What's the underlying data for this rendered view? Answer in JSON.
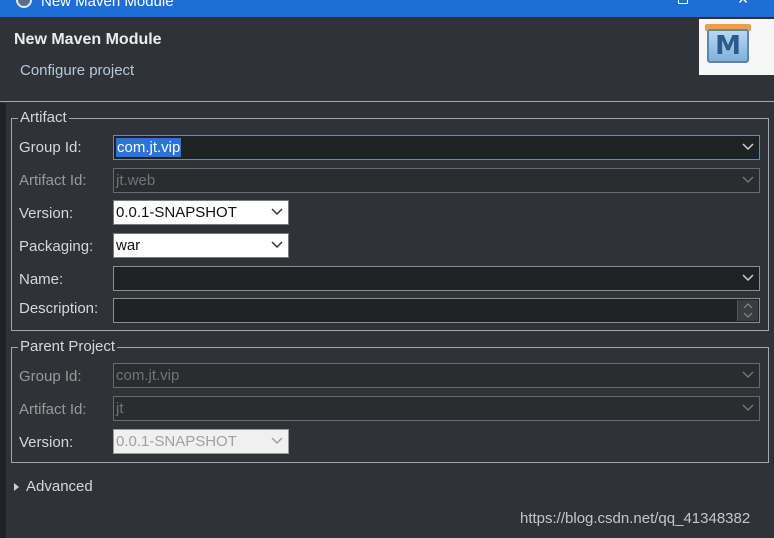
{
  "window": {
    "title": "New Maven Module"
  },
  "header": {
    "title": "New Maven Module",
    "subtitle": "Configure project",
    "logo_letter": "M"
  },
  "artifact": {
    "legend": "Artifact",
    "group_id": {
      "label": "Group Id:",
      "value": "com.jt.vip"
    },
    "artifact_id": {
      "label": "Artifact Id:",
      "value": "jt.web"
    },
    "version": {
      "label": "Version:",
      "value": "0.0.1-SNAPSHOT"
    },
    "packaging": {
      "label": "Packaging:",
      "value": "war"
    },
    "name": {
      "label": "Name:",
      "value": ""
    },
    "description": {
      "label": "Description:",
      "value": ""
    }
  },
  "parent": {
    "legend": "Parent Project",
    "group_id": {
      "label": "Group Id:",
      "value": "com.jt.vip"
    },
    "artifact_id": {
      "label": "Artifact Id:",
      "value": "jt"
    },
    "version": {
      "label": "Version:",
      "value": "0.0.1-SNAPSHOT"
    }
  },
  "advanced": {
    "label": "Advanced"
  },
  "watermark": "https://blog.csdn.net/qq_41348382",
  "colors": {
    "titlebar": "#1d6fd6",
    "background": "#2f3337",
    "selection": "#2a73d9"
  }
}
